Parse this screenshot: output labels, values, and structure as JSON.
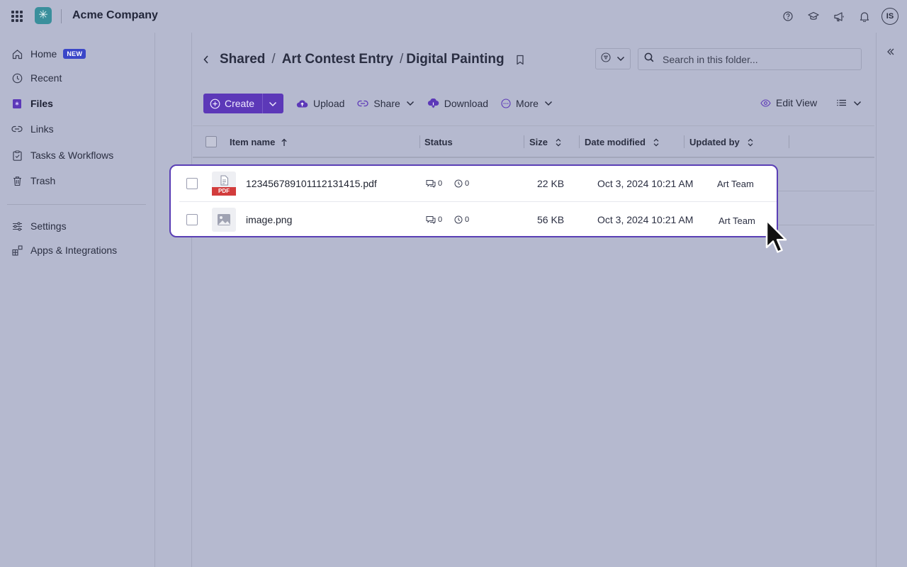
{
  "app": {
    "company": "Acme Company",
    "avatar_initials": "IS",
    "top_icons": [
      "help-icon",
      "learn-icon",
      "announcements-icon",
      "notifications-icon"
    ]
  },
  "sidebar": {
    "items": [
      {
        "label": "Home",
        "icon": "home-icon",
        "badge": "NEW"
      },
      {
        "label": "Recent",
        "icon": "clock-icon"
      },
      {
        "label": "Files",
        "icon": "files-icon",
        "active": true
      },
      {
        "label": "Links",
        "icon": "link-icon"
      },
      {
        "label": "Tasks & Workflows",
        "icon": "clipboard-icon"
      },
      {
        "label": "Trash",
        "icon": "trash-icon"
      },
      {
        "label": "Settings",
        "icon": "sliders-icon"
      },
      {
        "label": "Apps & Integrations",
        "icon": "apps-icon"
      }
    ]
  },
  "breadcrumb": {
    "items": [
      "Shared",
      "Art Contest Entry",
      "Digital Painting"
    ],
    "separator": "/"
  },
  "search": {
    "placeholder": "Search in this folder..."
  },
  "toolbar": {
    "create_label": "Create",
    "upload_label": "Upload",
    "share_label": "Share",
    "download_label": "Download",
    "more_label": "More",
    "edit_view_label": "Edit View"
  },
  "table": {
    "columns": [
      "Item name",
      "Status",
      "Size",
      "Date modified",
      "Updated by"
    ],
    "rows": [
      {
        "name": "123456789101112131415.pdf",
        "type_badge": "PDF",
        "comments": "0",
        "versions": "0",
        "size": "22 KB",
        "date": "Oct 3, 2024 10:21 AM",
        "updated_by": "Art Team"
      },
      {
        "name": "image.png",
        "comments": "0",
        "versions": "0",
        "size": "56 KB",
        "date": "Oct 3, 2024 10:21 AM",
        "updated_by": "Art Team"
      }
    ]
  },
  "colors": {
    "accent": "#5c38b8",
    "overlay_bg": "#b5b9cf",
    "pdf_red": "#d23c3c",
    "badge_blue": "#3a46c8"
  }
}
